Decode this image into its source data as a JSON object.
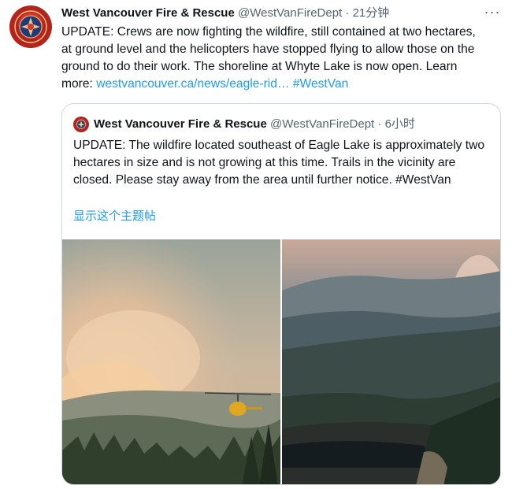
{
  "tweet": {
    "author_name": "West Vancouver Fire & Rescue",
    "handle": "@WestVanFireDept",
    "separator": "·",
    "time": "21分钟",
    "more_label": "···",
    "text": "UPDATE: Crews are now fighting the wildfire, still contained at two hectares, at ground level and the helicopters have stopped flying to allow those on the ground to do their work. The shoreline at Whyte Lake is now open. Learn more: ",
    "link": "westvancouver.ca/news/eagle-rid…",
    "hashtag": "#WestVan"
  },
  "quoted": {
    "author_name": "West Vancouver Fire & Rescue",
    "handle": "@WestVanFireDept",
    "separator": "·",
    "time": "6小时",
    "text": "UPDATE: The wildfire located southeast of Eagle Lake is approximately two hectares in size and is not growing at this time. Trails in the vicinity are closed. Please stay away from the area until further notice. #WestVan",
    "show_thread": "显示这个主题帖"
  },
  "icons": {
    "avatar": "fire-rescue-badge-icon",
    "more": "more-options-icon"
  },
  "colors": {
    "link": "#1d9bf0",
    "muted": "#536471",
    "text": "#0f1419",
    "border": "#cfd9de",
    "badge_red": "#b3241c"
  }
}
